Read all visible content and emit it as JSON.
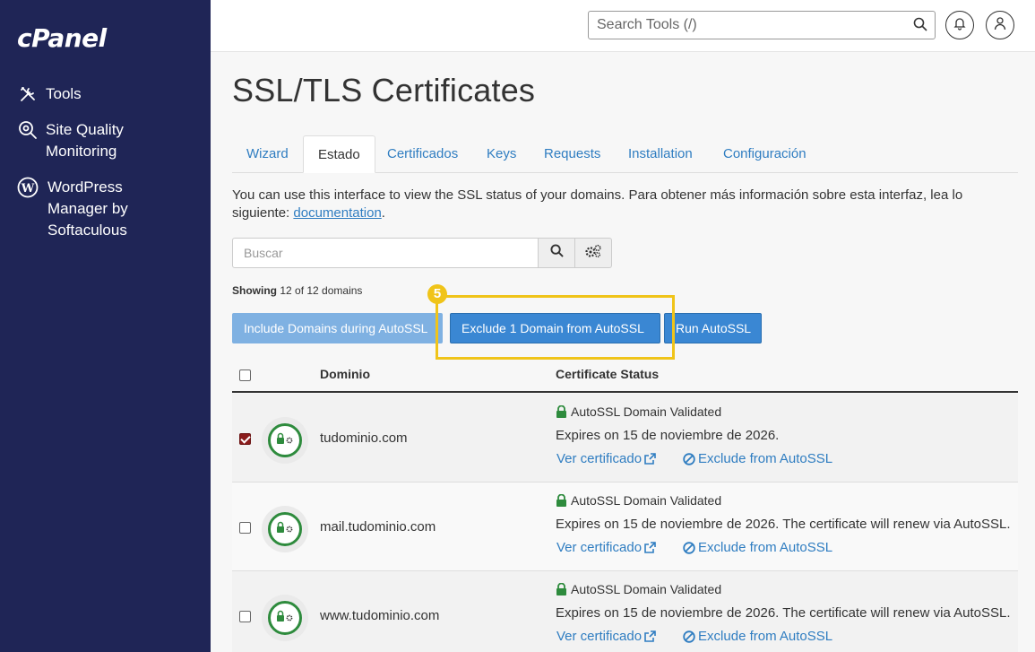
{
  "sidebar": {
    "logo": "cPanel",
    "items": [
      {
        "label": "Tools"
      },
      {
        "label": "Site Quality\nMonitoring"
      },
      {
        "label": "WordPress\n  Manager by\nSoftaculous"
      }
    ]
  },
  "header": {
    "search_placeholder": "Search Tools (/)"
  },
  "page": {
    "title": "SSL/TLS Certificates",
    "tabs": [
      {
        "label": "Wizard",
        "active": false
      },
      {
        "label": "Estado",
        "active": true
      },
      {
        "label": "Certificados",
        "active": false
      },
      {
        "label": "Keys",
        "active": false
      },
      {
        "label": "Requests",
        "active": false
      },
      {
        "label": "Installation",
        "active": false
      },
      {
        "label": "Configuración",
        "active": false
      }
    ],
    "intro_text": "You can use this interface to view the SSL status of your domains. Para obtener más información sobre esta interfaz, lea lo siguiente: ",
    "intro_link": "documentation",
    "intro_end": ".",
    "search_placeholder": "Buscar",
    "showing_label": "Showing",
    "showing_count": "12 of 12 domains",
    "buttons": {
      "include": "Include Domains during AutoSSL",
      "exclude": "Exclude 1 Domain from AutoSSL",
      "run": "Run AutoSSL"
    },
    "step_number": "5"
  },
  "table": {
    "headers": {
      "domain": "Dominio",
      "status": "Certificate Status"
    },
    "rows": [
      {
        "domain": "tudominio.com",
        "checked": true,
        "status_title": "AutoSSL Domain Validated",
        "expires": "Expires on 15 de noviembre de 2026.",
        "view_link": "Ver certificado",
        "exclude_link": "Exclude from AutoSSL"
      },
      {
        "domain": "mail.tudominio.com",
        "checked": false,
        "status_title": "AutoSSL Domain Validated",
        "expires": "Expires on 15 de noviembre de 2026. The certificate will renew via AutoSSL.",
        "view_link": "Ver certificado",
        "exclude_link": "Exclude from AutoSSL"
      },
      {
        "domain": "www.tudominio.com",
        "checked": false,
        "status_title": "AutoSSL Domain Validated",
        "expires": "Expires on 15 de noviembre de 2026. The certificate will renew via AutoSSL.",
        "view_link": "Ver certificado",
        "exclude_link": "Exclude from AutoSSL"
      }
    ]
  },
  "colors": {
    "sidebar": "#1f2556",
    "link": "#2f7dc1",
    "primary_button": "#3a87d3",
    "disabled_button": "#7fb1e2",
    "highlight": "#f0c419",
    "ssl_green": "#2e8b3d",
    "checkbox_checked": "#8b1c1c"
  },
  "icons": {
    "tools": "tools-icon",
    "site_quality": "magnifier-gear-icon",
    "wordpress": "wordpress-icon",
    "search": "search-icon",
    "bell": "bell-icon",
    "user": "user-icon",
    "gears": "gears-icon",
    "lock": "lock-icon",
    "external": "external-link-icon",
    "ban": "ban-icon"
  }
}
